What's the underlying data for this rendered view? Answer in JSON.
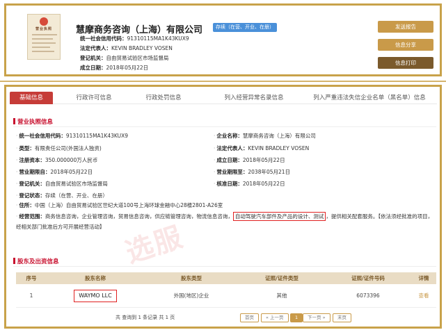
{
  "header": {
    "license_thumb_title": "营业执照",
    "company_name": "慧摩商务咨询（上海）有限公司",
    "status_badge": "存续（在营、开业、在册）",
    "rows": [
      {
        "label": "统一社会信用代码：",
        "value": "91310115MA1K43KUX9"
      },
      {
        "label": "法定代表人：",
        "value": "KEVIN BRADLEY VOSEN"
      },
      {
        "label": "登记机关：",
        "value": "自由贸易试验区市场监督局"
      },
      {
        "label": "成立日期：",
        "value": "2018年05月22日"
      }
    ],
    "buttons": {
      "report": "发送报告",
      "share": "信息分享",
      "print": "信息打印"
    }
  },
  "tabs": [
    {
      "label": "基础信息"
    },
    {
      "label": "行政许可信息"
    },
    {
      "label": "行政处罚信息"
    },
    {
      "label": "列入经营异常名录信息"
    },
    {
      "label": "列入严重违法失信企业名单（黑名单）信息"
    }
  ],
  "license_section": {
    "title": "营业执照信息",
    "left": [
      {
        "label": "统一社会信用代码：",
        "value": "91310115MA1K43KUX9"
      },
      {
        "label": "类型：",
        "value": "有限责任公司(外国法人独资)"
      },
      {
        "label": "注册资本：",
        "value": "350.000000万人民币"
      },
      {
        "label": "营业期限自：",
        "value": "2018年05月22日"
      },
      {
        "label": "登记机关：",
        "value": "自由贸易试验区市场监督局"
      },
      {
        "label": "登记状态：",
        "value": "存续（在营、开业、在册）"
      }
    ],
    "right": [
      {
        "label": "企业名称：",
        "value": "慧摩商务咨询（上海）有限公司"
      },
      {
        "label": "法定代表人：",
        "value": "KEVIN BRADLEY VOSEN"
      },
      {
        "label": "成立日期：",
        "value": "2018年05月22日"
      },
      {
        "label": "营业期限至：",
        "value": "2038年05月21日"
      },
      {
        "label": "核准日期：",
        "value": "2018年05月22日"
      }
    ],
    "address": {
      "label": "住所：",
      "value": "中国（上海）自由贸易试验区世纪大道100号上海环球金融中心28楼2801-A26室"
    },
    "scope": {
      "label": "经营范围：",
      "before": "商务信息咨询，企业管理咨询，贸易信息咨询，供应链管理咨询，物流信息咨询，",
      "highlight": "自动驾驶汽车部件及产品的设计、测试",
      "after": "，提供相关配套服务。【依法须经批准的项目，经相关部门批准后方可开展经营活动】"
    }
  },
  "watermark": "选服",
  "shareholder_section": {
    "title": "股东及出资信息",
    "columns": [
      "序号",
      "股东名称",
      "股东类型",
      "证照/证件类型",
      "证照/证件号码",
      "详情"
    ],
    "rows": [
      {
        "index": "1",
        "name": "WAYMO LLC",
        "type": "外国(地区)企业",
        "cert_type": "其他",
        "cert_no": "6073396",
        "detail": "查看"
      }
    ],
    "pager": {
      "info": "共 查询到 1 条记录 共 1 页",
      "first": "首页",
      "prev": "« 上一页",
      "current": "1",
      "next": "下一页 »",
      "last": "末页"
    }
  }
}
